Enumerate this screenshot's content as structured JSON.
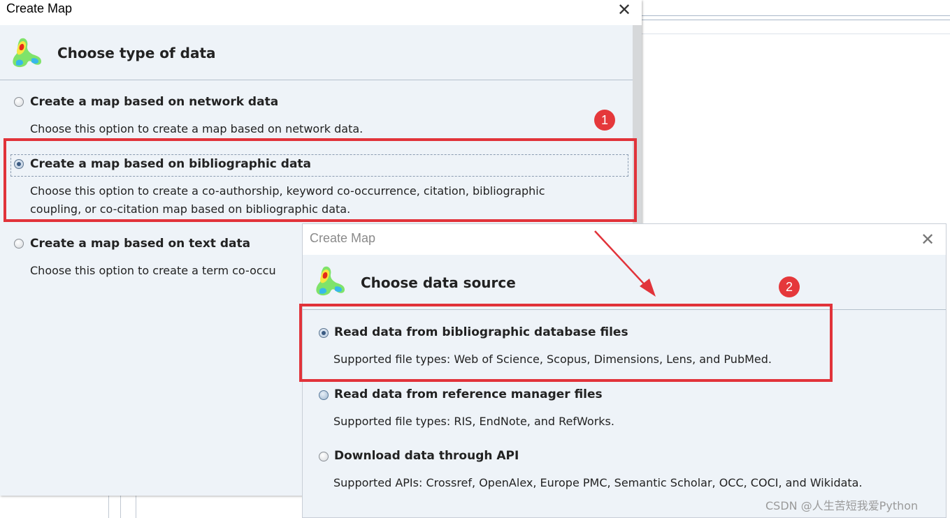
{
  "dialog1": {
    "title": "Create Map",
    "heading": "Choose type of data",
    "options": [
      {
        "label": "Create a map based on network data",
        "description": "Choose this option to create a map based on network data."
      },
      {
        "label": "Create a map based on bibliographic data",
        "description_line1": "Choose this option to create a co-authorship, keyword co-occurrence, citation, bibliographic",
        "description_line2": "coupling, or co-citation map based on bibliographic data."
      },
      {
        "label": "Create a map based on text data",
        "description": "Choose this option to create a term co-occu"
      }
    ],
    "selected_option": "Create a map based on bibliographic data"
  },
  "dialog2": {
    "title": "Create Map",
    "heading": "Choose data source",
    "options": [
      {
        "label": "Read data from bibliographic database files",
        "description": "Supported file types: Web of Science, Scopus, Dimensions, Lens, and PubMed."
      },
      {
        "label": "Read data from reference manager files",
        "description": "Supported file types: RIS, EndNote, and RefWorks."
      },
      {
        "label": "Download data through API",
        "description": "Supported APIs: Crossref, OpenAlex, Europe PMC, Semantic Scholar, OCC, COCI, and Wikidata."
      }
    ],
    "selected_option": "Read data from bibliographic database files"
  },
  "annotations": {
    "badge1": "1",
    "badge2": "2",
    "highlight_color": "#e1333a"
  },
  "watermark": "CSDN @人生苦短我爱Python",
  "icons": {
    "close": "close-icon",
    "logo": "vosviewer-logo-icon"
  },
  "colors": {
    "dialog_bg": "#eef3f8",
    "annotation_red": "#e1333a"
  }
}
